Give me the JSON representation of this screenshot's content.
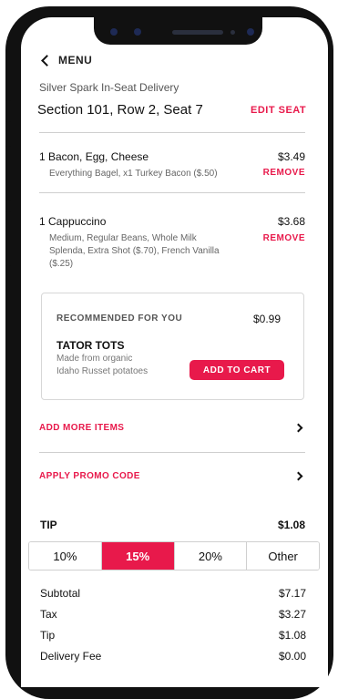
{
  "nav": {
    "back_label": "MENU"
  },
  "delivery": {
    "venue": "Silver Spark In-Seat Delivery",
    "seat": "Section 101, Row 2, Seat 7",
    "edit_label": "EDIT SEAT"
  },
  "cart": {
    "items": [
      {
        "name": "1 Bacon, Egg, Cheese",
        "price": "$3.49",
        "desc": "Everything Bagel, x1 Turkey Bacon ($.50)",
        "remove_label": "REMOVE"
      },
      {
        "name": "1 Cappuccino",
        "price": "$3.68",
        "desc_lines": [
          "Medium, Regular Beans, Whole Milk",
          "Splenda, Extra Shot ($.70), French Vanilla",
          "($.25)"
        ],
        "remove_label": "REMOVE"
      }
    ]
  },
  "recommended": {
    "heading": "RECOMMENDED FOR YOU",
    "price": "$0.99",
    "name": "TATOR TOTS",
    "desc_lines": [
      "Made from organic",
      "Idaho Russet potatoes"
    ],
    "add_label": "ADD TO CART"
  },
  "links": {
    "add_more": "ADD MORE ITEMS",
    "promo": "APPLY PROMO CODE"
  },
  "tip": {
    "label": "TIP",
    "value": "$1.08",
    "options": [
      "10%",
      "15%",
      "20%",
      "Other"
    ],
    "selected": "15%"
  },
  "summary": [
    {
      "label": "Subtotal",
      "value": "$7.17"
    },
    {
      "label": "Tax",
      "value": "$3.27"
    },
    {
      "label": "Tip",
      "value": "$1.08"
    },
    {
      "label": "Delivery Fee",
      "value": "$0.00"
    }
  ],
  "colors": {
    "accent": "#e8194b",
    "device": "#111111"
  }
}
